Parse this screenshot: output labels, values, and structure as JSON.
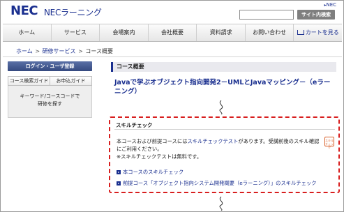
{
  "header": {
    "logo": "NEC",
    "brand": "NECラーニング",
    "top_link": "NEC",
    "search_placeholder": "",
    "search_button": "サイト内検索"
  },
  "nav": {
    "items": [
      "ホーム",
      "サービス",
      "会場案内",
      "会社概要",
      "資料請求",
      "お問い合わせ",
      "カートを見る"
    ]
  },
  "breadcrumb": {
    "home": "ホーム",
    "training": "研修サービス",
    "current": "コース概要",
    "separator": ">"
  },
  "sidebar": {
    "login": "ログイン・ユーザ登録",
    "tabs": [
      "コース検索ガイド",
      "お申込ガイド"
    ],
    "search_line1": "キーワード/コースコードで",
    "search_line2": "研修を探す"
  },
  "main": {
    "section_heading": "コース概要",
    "course_title": "Javaで学ぶオブジェクト指向開発2－UMLとJavaマッピング－（eラーニング）"
  },
  "skill_check": {
    "title": "スキルチェック",
    "icon_text": "スキルチェック",
    "text_before": "本コースおよび前提コースには",
    "text_link": "スキルチェックテスト",
    "text_after": "があります。受講前後のスキル確認にご利用ください。",
    "note": "※スキルチェックテストは無料です。",
    "link1": "本コースのスキルチェック",
    "link2": "前提コース「オブジェクト指向システム開発概要（eラーニング）」のスキルチェック"
  },
  "colors": {
    "brand_blue": "#1a2f8f",
    "highlight_red": "#d81e1e"
  }
}
